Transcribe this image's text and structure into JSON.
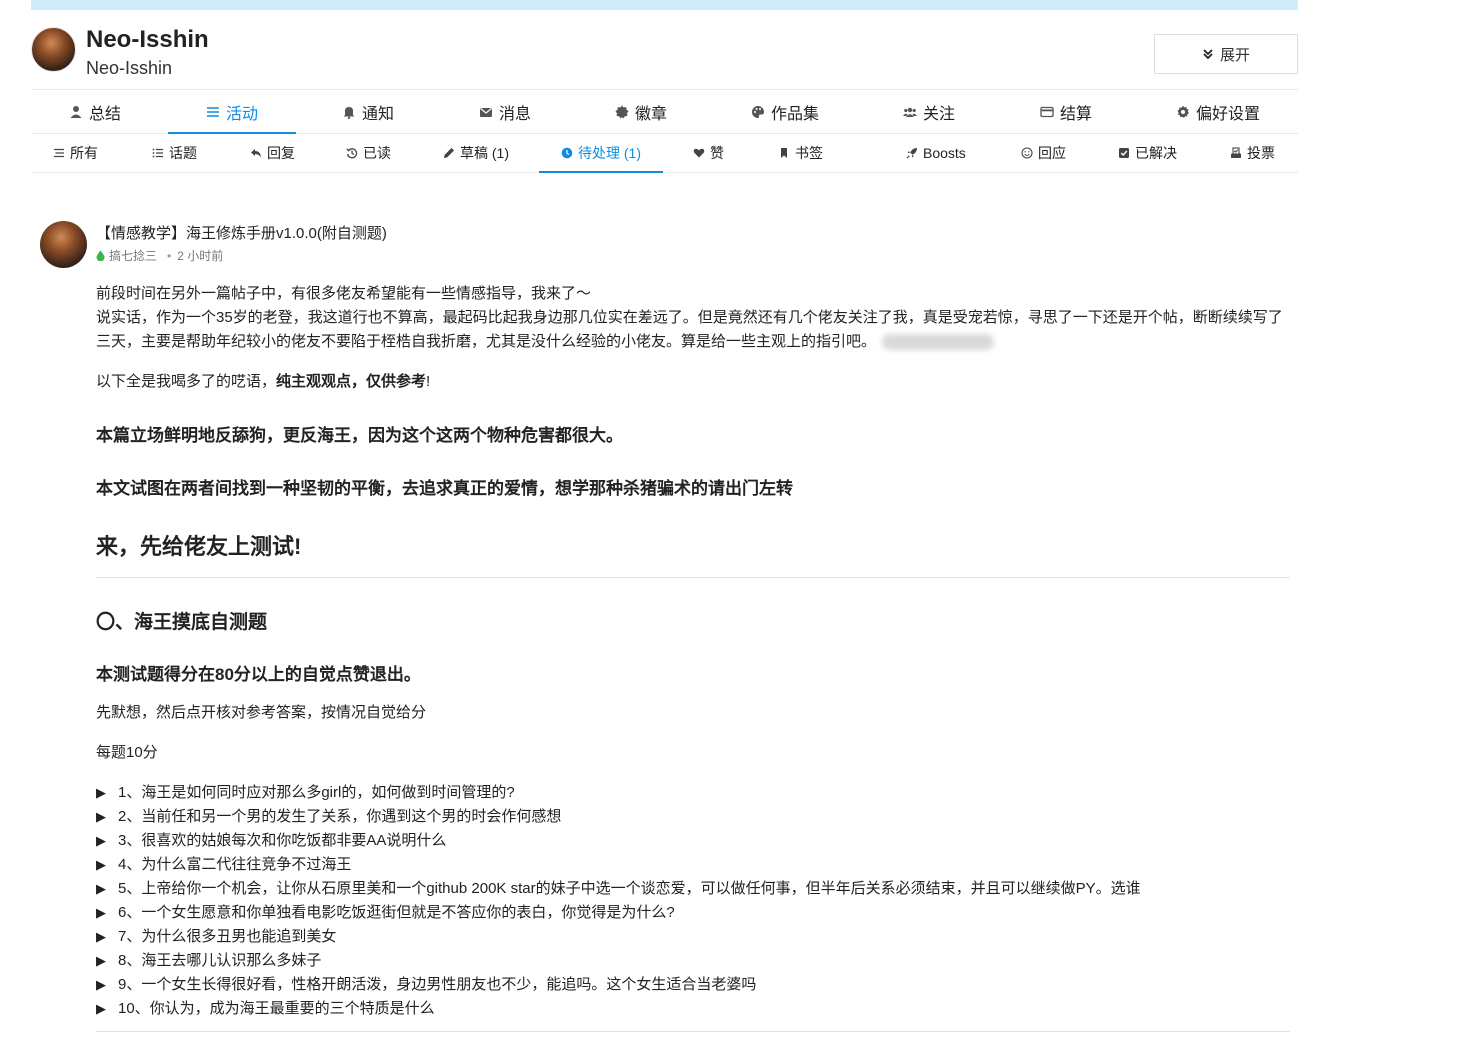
{
  "profile": {
    "name": "Neo-Isshin",
    "username": "Neo-Isshin",
    "expand_label": "展开"
  },
  "main_nav": [
    {
      "key": "summary",
      "label": "总结",
      "icon": "user-icon"
    },
    {
      "key": "activity",
      "label": "活动",
      "icon": "list-icon",
      "active": true
    },
    {
      "key": "notifications",
      "label": "通知",
      "icon": "bell-icon"
    },
    {
      "key": "messages",
      "label": "消息",
      "icon": "envelope-icon"
    },
    {
      "key": "badges",
      "label": "徽章",
      "icon": "certificate-icon"
    },
    {
      "key": "portfolio",
      "label": "作品集",
      "icon": "palette-icon"
    },
    {
      "key": "follow",
      "label": "关注",
      "icon": "users-icon"
    },
    {
      "key": "billing",
      "label": "结算",
      "icon": "credit-card-icon"
    },
    {
      "key": "preferences",
      "label": "偏好设置",
      "icon": "gear-icon"
    }
  ],
  "sub_nav": [
    {
      "key": "all",
      "label": "所有",
      "icon": "stream-icon"
    },
    {
      "key": "topics",
      "label": "话题",
      "icon": "list-ul-icon"
    },
    {
      "key": "replies",
      "label": "回复",
      "icon": "reply-icon"
    },
    {
      "key": "read",
      "label": "已读",
      "icon": "history-icon"
    },
    {
      "key": "drafts",
      "label": "草稿 (1)",
      "icon": "pencil-icon"
    },
    {
      "key": "pending",
      "label": "待处理 (1)",
      "icon": "clock-icon",
      "active": true
    },
    {
      "key": "likes",
      "label": "赞",
      "icon": "heart-icon"
    },
    {
      "key": "bookmarks",
      "label": "书签",
      "icon": "bookmark-icon"
    },
    {
      "key": "boosts",
      "label": "Boosts",
      "icon": "rocket-icon"
    },
    {
      "key": "reactions",
      "label": "回应",
      "icon": "smile-icon"
    },
    {
      "key": "solved",
      "label": "已解决",
      "icon": "check-square-icon"
    },
    {
      "key": "votes",
      "label": "投票",
      "icon": "vote-icon"
    }
  ],
  "post": {
    "title": "【情感教学】海王修炼手册v1.0.0(附自测题)",
    "category": "搞七捻三",
    "time": "2 小时前",
    "intro_1": "前段时间在另外一篇帖子中，有很多佬友希望能有一些情感指导，我来了～",
    "intro_2": "说实话，作为一个35岁的老登，我这道行也不算高，最起码比起我身边那几位实在差远了。但是竟然还有几个佬友关注了我，真是受宠若惊，寻思了一下还是开个帖，断断续续写了三天，主要是帮助年纪较小的佬友不要陷于桎梏自我折磨，尤其是没什么经验的小佬友。算是给一些主观上的指引吧。",
    "disclaimer_pre": "以下全是我喝多了的呓语，",
    "disclaimer_bold": "纯主观观点，仅供参考",
    "disclaimer_post": "!",
    "stance": "本篇立场鲜明地反舔狗，更反海王，因为这个这两个物种危害都很大。",
    "goal": "本文试图在两者间找到一种坚韧的平衡，去追求真正的爱情，想学那种杀猪骗术的请出门左转",
    "test_heading": "来，先给佬友上测试!",
    "section_heading": "〇、海王摸底自测题",
    "score_note": "本测试题得分在80分以上的自觉点赞退出。",
    "instruction": "先默想，然后点开核对参考答案，按情况自觉给分",
    "points": "每题10分",
    "questions": [
      "1、海王是如何同时应对那么多girl的，如何做到时间管理的?",
      "2、当前任和另一个男的发生了关系，你遇到这个男的时会作何感想",
      "3、很喜欢的姑娘每次和你吃饭都非要AA说明什么",
      "4、为什么富二代往往竞争不过海王",
      "5、上帝给你一个机会，让你从石原里美和一个github 200K star的妹子中选一个谈恋爱，可以做任何事，但半年后关系必须结束，并且可以继续做PY。选谁",
      "6、一个女生愿意和你单独看电影吃饭逛街但就是不答应你的表白，你觉得是为什么?",
      "7、为什么很多丑男也能追到美女",
      "8、海王去哪儿认识那么多妹子",
      "9、一个女生长得很好看，性格开朗活泼，身边男性朋友也不少，能追吗。这个女生适合当老婆吗",
      "10、你认为，成为海王最重要的三个特质是什么"
    ]
  },
  "colors": {
    "accent": "#0e8de0",
    "top_strip": "#d1ecfb",
    "category_drop": "#3ab54a"
  }
}
